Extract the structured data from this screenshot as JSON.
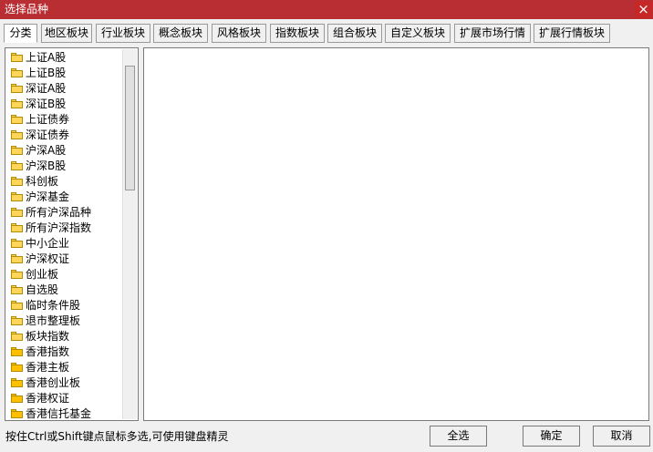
{
  "window": {
    "title": "选择品种",
    "close_label": "×"
  },
  "tabs": [
    {
      "label": "分类",
      "active": true
    },
    {
      "label": "地区板块"
    },
    {
      "label": "行业板块"
    },
    {
      "label": "概念板块"
    },
    {
      "label": "风格板块"
    },
    {
      "label": "指数板块"
    },
    {
      "label": "组合板块"
    },
    {
      "label": "自定义板块"
    },
    {
      "label": "扩展市场行情"
    },
    {
      "label": "扩展行情板块"
    }
  ],
  "tree": {
    "items": [
      {
        "label": "上证A股",
        "icon": "folder-icon"
      },
      {
        "label": "上证B股",
        "icon": "folder-icon"
      },
      {
        "label": "深证A股",
        "icon": "folder-icon"
      },
      {
        "label": "深证B股",
        "icon": "folder-icon"
      },
      {
        "label": "上证债券",
        "icon": "folder-icon"
      },
      {
        "label": "深证债券",
        "icon": "folder-icon"
      },
      {
        "label": "沪深A股",
        "icon": "folder-icon"
      },
      {
        "label": "沪深B股",
        "icon": "folder-icon"
      },
      {
        "label": "科创板",
        "icon": "folder-icon"
      },
      {
        "label": "沪深基金",
        "icon": "folder-icon"
      },
      {
        "label": "所有沪深品种",
        "icon": "folder-icon"
      },
      {
        "label": "所有沪深指数",
        "icon": "folder-icon"
      },
      {
        "label": "中小企业",
        "icon": "folder-icon"
      },
      {
        "label": "沪深权证",
        "icon": "folder-icon"
      },
      {
        "label": "创业板",
        "icon": "folder-icon"
      },
      {
        "label": "自选股",
        "icon": "folder-icon"
      },
      {
        "label": "临时条件股",
        "icon": "folder-icon"
      },
      {
        "label": "退市整理板",
        "icon": "folder-icon"
      },
      {
        "label": "板块指数",
        "icon": "folder-icon"
      },
      {
        "label": "香港指数",
        "icon": "folder-icon"
      },
      {
        "label": "香港主板",
        "icon": "folder-icon"
      },
      {
        "label": "香港创业板",
        "icon": "folder-icon"
      },
      {
        "label": "香港权证",
        "icon": "folder-icon"
      },
      {
        "label": "香港信托基金",
        "icon": "folder-icon"
      }
    ]
  },
  "footer": {
    "hint": "按住Ctrl或Shift键点鼠标多选,可使用键盘精灵",
    "select_all_label": "全选",
    "ok_label": "确定",
    "cancel_label": "取消"
  }
}
